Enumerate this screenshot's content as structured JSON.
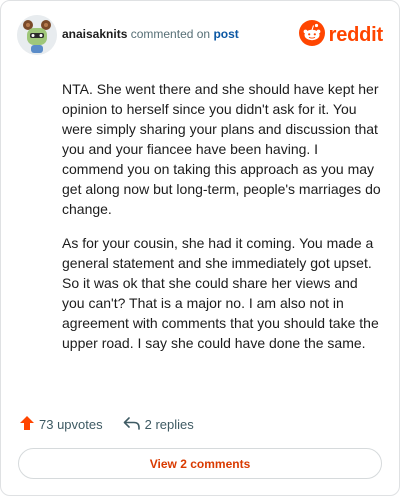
{
  "comment": {
    "username": "anaisaknits",
    "action_text": "commented on",
    "post_link": "post",
    "paragraphs": [
      "NTA. She went there and she should have kept her opinion to herself since you didn't ask for it. You were simply sharing your plans and discussion that you and your fiancee have been having. I commend you on taking this approach as you may get along now but long-term, people's marriages do change.",
      "As for your cousin, she had it coming. You made a general statement and she immediately got upset. So it was ok that she could share her views and you can't? That is a major no. I am also not in agreement with comments that you should take the upper road. I say she could have done the same."
    ],
    "upvotes_label": "73 upvotes",
    "replies_label": "2 replies"
  },
  "brand": {
    "wordmark": "reddit",
    "color": "#ff4500"
  },
  "cta": {
    "view_comments_label": "View 2 comments"
  },
  "colors": {
    "upvote_arrow": "#ff4500",
    "link_blue": "#0b57a3",
    "cta_text": "#d93a00"
  },
  "icons": {
    "avatar": "avatar-icon",
    "logo": "reddit-logo-icon",
    "upvote": "upvote-arrow-icon",
    "reply": "reply-arrow-icon"
  }
}
